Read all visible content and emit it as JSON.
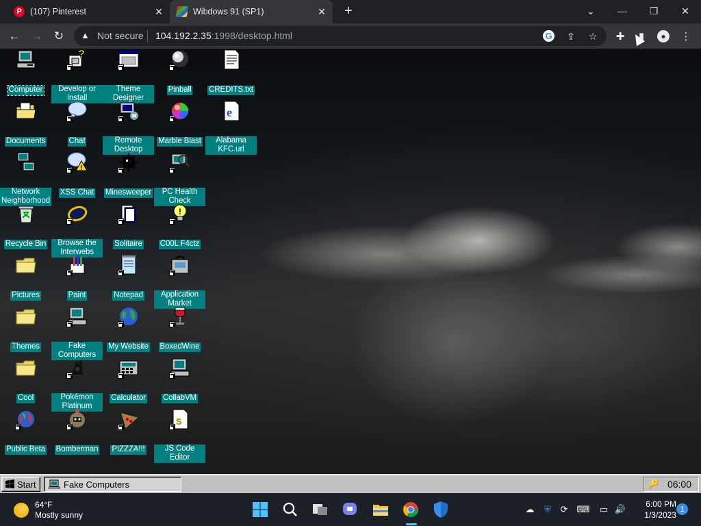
{
  "browser": {
    "tabs": [
      {
        "title": "(107) Pinterest",
        "favicon": "P"
      },
      {
        "title": "Wibdows 91 (SP1)",
        "active": true
      }
    ],
    "new_tab": "+",
    "address": {
      "security": "Not secure",
      "host": "104.192.2.35",
      "path": ":1998/desktop.html"
    }
  },
  "desktop": {
    "icons": [
      {
        "label": "Computer",
        "icon": "computer-icon",
        "selected": true
      },
      {
        "label": "Develop or Install",
        "icon": "develop-icon"
      },
      {
        "label": "Theme Designer",
        "icon": "theme-designer-icon"
      },
      {
        "label": "Pinball",
        "icon": "pinball-icon"
      },
      {
        "label": "CREDITS.txt",
        "icon": "text-file-icon"
      },
      {
        "label": "Documents",
        "icon": "documents-folder-icon"
      },
      {
        "label": "Chat",
        "icon": "chat-icon"
      },
      {
        "label": "Remote Desktop",
        "icon": "remote-desktop-icon"
      },
      {
        "label": "Marble Blast",
        "icon": "marble-icon"
      },
      {
        "label": "Alabama KFC.url",
        "icon": "internet-shortcut-icon"
      },
      {
        "label": "Network Neighborhood",
        "icon": "network-icon"
      },
      {
        "label": "XSS Chat",
        "icon": "warning-chat-icon"
      },
      {
        "label": "Minesweeper",
        "icon": "mine-icon"
      },
      {
        "label": "PC Health Check",
        "icon": "health-check-icon"
      },
      {
        "label": "Recycle Bin",
        "icon": "recycle-bin-icon"
      },
      {
        "label": "Browse the Interwebs",
        "icon": "browser-icon"
      },
      {
        "label": "Solitaire",
        "icon": "solitaire-icon"
      },
      {
        "label": "C00L F4ctz",
        "icon": "lightbulb-icon"
      },
      {
        "label": "Pictures",
        "icon": "folder-icon"
      },
      {
        "label": "Paint",
        "icon": "paint-icon"
      },
      {
        "label": "Notepad",
        "icon": "notepad-icon"
      },
      {
        "label": "Application Market",
        "icon": "market-icon"
      },
      {
        "label": "Themes",
        "icon": "folder-icon"
      },
      {
        "label": "Fake Computers",
        "icon": "fake-computer-icon"
      },
      {
        "label": "My Website",
        "icon": "globe-icon"
      },
      {
        "label": "BoxedWine",
        "icon": "wine-icon"
      },
      {
        "label": "Cool",
        "icon": "folder-icon"
      },
      {
        "label": "Pokémon Platinum",
        "icon": "pokemon-icon"
      },
      {
        "label": "Calculator",
        "icon": "calculator-icon"
      },
      {
        "label": "CollabVM",
        "icon": "collabvm-icon"
      },
      {
        "label": "Public Beta",
        "icon": "public-beta-icon"
      },
      {
        "label": "Bomberman",
        "icon": "bomberman-icon"
      },
      {
        "label": "PIZZZA!!!",
        "icon": "pizza-icon"
      },
      {
        "label": "JS Code Editor",
        "icon": "code-editor-icon"
      }
    ]
  },
  "win9x_taskbar": {
    "start_label": "Start",
    "task_label": "Fake Computers",
    "clock": "06:00"
  },
  "win11_taskbar": {
    "weather_temp": "64°F",
    "weather_desc": "Mostly sunny",
    "time": "6:00 PM",
    "date": "1/3/2023",
    "notifications": "1"
  }
}
